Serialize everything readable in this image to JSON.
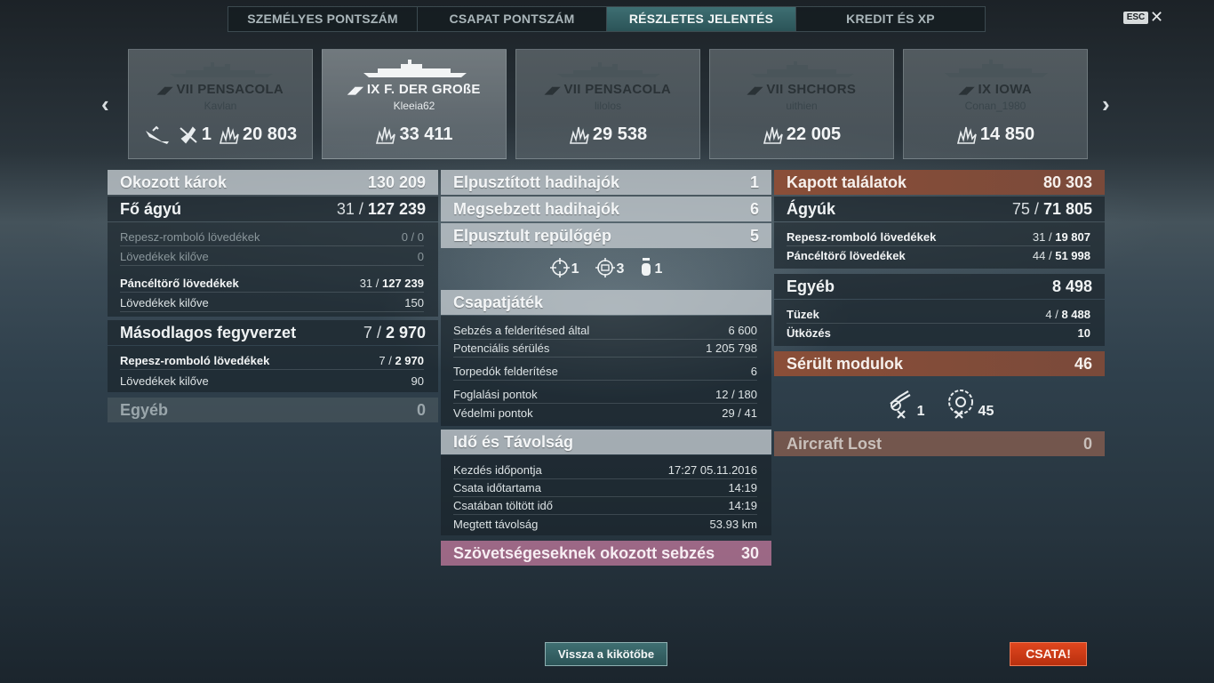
{
  "tabs": [
    {
      "label": "SZEMÉLYES PONTSZÁM",
      "active": false
    },
    {
      "label": "CSAPAT PONTSZÁM",
      "active": false
    },
    {
      "label": "RÉSZLETES JELENTÉS",
      "active": true
    },
    {
      "label": "KREDIT ÉS XP",
      "active": false
    }
  ],
  "esc_label": "ESC",
  "close_icon": "close-icon",
  "nav": {
    "prev_icon": "chevron-left-icon",
    "next_icon": "chevron-right-icon"
  },
  "ships": [
    {
      "tier": "VII",
      "name": "PENSACOLA",
      "player": "Kavlan",
      "highlight": false,
      "stats": {
        "ships_sunk_icon": "sunk-ship-icon",
        "planes": "1",
        "damage": "20 803"
      }
    },
    {
      "tier": "IX",
      "name": "F. DER GROßE",
      "player": "Kleeia62",
      "highlight": true,
      "stats": {
        "damage": "33 411"
      }
    },
    {
      "tier": "VII",
      "name": "PENSACOLA",
      "player": "lilolos",
      "highlight": false,
      "stats": {
        "damage": "29 538"
      }
    },
    {
      "tier": "VII",
      "name": "SHCHORS",
      "player": "uithien",
      "highlight": false,
      "stats": {
        "damage": "22 005"
      }
    },
    {
      "tier": "IX",
      "name": "IOWA",
      "player": "Conan_1980",
      "highlight": false,
      "stats": {
        "damage": "14 850"
      }
    }
  ],
  "left": {
    "damage_title": "Okozott károk",
    "damage_value": "130 209",
    "main_title": "Fő ágyú",
    "main_hits": "31",
    "main_total": "127 239",
    "he_label": "Repesz-romboló lövedékek",
    "he_value": "0 / 0",
    "he_fired_label": "Lövedékek kilőve",
    "he_fired_value": "0",
    "ap_label": "Páncéltörő lövedékek",
    "ap_hits": "31 /",
    "ap_total": "127 239",
    "ap_fired_label": "Lövedékek kilőve",
    "ap_fired_value": "150",
    "sec_title": "Másodlagos fegyverzet",
    "sec_hits": "7",
    "sec_total": "2 970",
    "sec_he_label": "Repesz-romboló lövedékek",
    "sec_he_hits": "7 /",
    "sec_he_total": "2 970",
    "sec_fired_label": "Lövedékek kilőve",
    "sec_fired_value": "90",
    "other_title": "Egyéb",
    "other_value": "0"
  },
  "middle": {
    "destroyed_label": "Elpusztított hadihajók",
    "destroyed_value": "1",
    "damaged_label": "Megsebzett hadihajók",
    "damaged_value": "6",
    "planes_label": "Elpusztult repülőgép",
    "planes_value": "5",
    "icons": [
      {
        "icon": "crosshair-icon",
        "value": "1"
      },
      {
        "icon": "citadel-icon",
        "value": "3"
      },
      {
        "icon": "fire-icon",
        "value": "1"
      }
    ],
    "team_title": "Csapatjáték",
    "spot_dmg_label": "Sebzés a felderítésed által",
    "spot_dmg_value": "6 600",
    "potential_label": "Potenciális sérülés",
    "potential_value": "1 205 798",
    "torp_spot_label": "Torpedók felderítése",
    "torp_spot_value": "6",
    "capture_label": "Foglalási pontok",
    "capture_value": "12 / 180",
    "defense_label": "Védelmi pontok",
    "defense_value": "29 / 41",
    "time_title": "Idő és Távolság",
    "start_label": "Kezdés időpontja",
    "start_value": "17:27  05.11.2016",
    "duration_label": "Csata időtartama",
    "duration_value": "14:19",
    "time_in_label": "Csatában töltött idő",
    "time_in_value": "14:19",
    "distance_label": "Megtett távolság",
    "distance_value": "53.93 km",
    "ally_title": "Szövetségeseknek okozott sebzés",
    "ally_value": "30"
  },
  "right": {
    "received_title": "Kapott találatok",
    "received_value": "80 303",
    "guns_title": "Ágyúk",
    "guns_hits": "75",
    "guns_total": "71 805",
    "he_label": "Repesz-romboló lövedékek",
    "he_hits": "31 /",
    "he_total": "19 807",
    "ap_label": "Páncéltörő lövedékek",
    "ap_hits": "44 /",
    "ap_total": "51 998",
    "other_title": "Egyéb",
    "other_value": "8 498",
    "fire_label": "Tüzek",
    "fire_hits": "4 /",
    "fire_total": "8 488",
    "ram_label": "Ütközés",
    "ram_value": "10",
    "modules_title": "Sérült modulok",
    "modules_value": "46",
    "module_icons": [
      {
        "icon": "gun-turret-icon",
        "value": "1"
      },
      {
        "icon": "steering-gear-icon",
        "value": "45"
      }
    ],
    "aircraft_title": "Aircraft Lost",
    "aircraft_value": "0"
  },
  "buttons": {
    "port": "Vissza a kikötőbe",
    "battle": "CSATA!"
  }
}
